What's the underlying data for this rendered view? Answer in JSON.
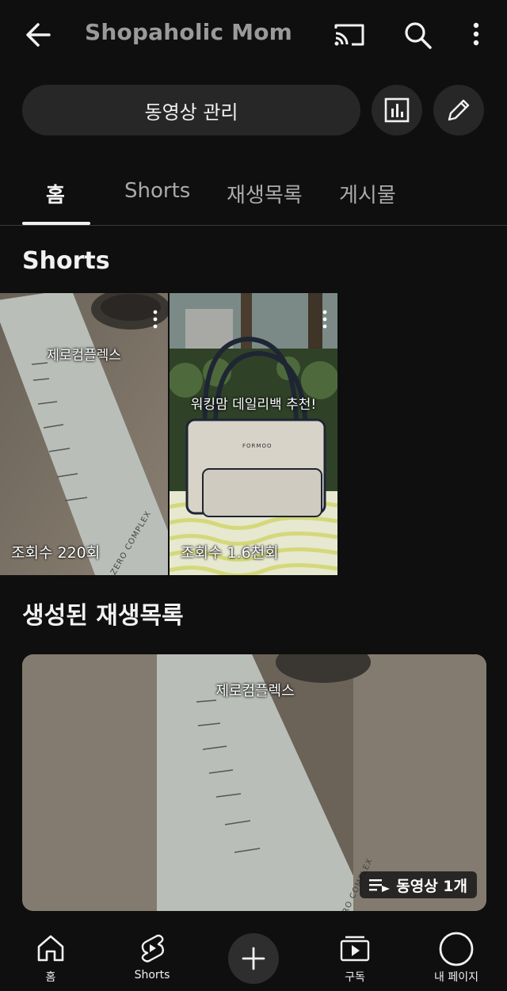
{
  "header": {
    "channel_name": "Shopaholic Mom"
  },
  "actions": {
    "manage_videos_label": "동영상 관리"
  },
  "tabs": [
    {
      "label": "홈",
      "active": true
    },
    {
      "label": "Shorts",
      "active": false
    },
    {
      "label": "재생목록",
      "active": false
    },
    {
      "label": "게시물",
      "active": false
    }
  ],
  "shorts_section": {
    "title": "Shorts",
    "items": [
      {
        "overlay_text": "제로컴플렉스",
        "views": "조회수 220회",
        "sheet_text": "ZERO COMPLEX"
      },
      {
        "overlay_text": "워킹맘 데일리백 추천!",
        "views": "조회수 1.6천회",
        "bag_brand": "FORMOO"
      }
    ]
  },
  "playlists_section": {
    "title": "생성된 재생목록",
    "thumb_overlay_text": "제로컴플렉스",
    "thumb_sheet_text": "ZERO COMPLEX",
    "badge": "동영상 1개"
  },
  "bottom_nav": {
    "home": "홈",
    "shorts": "Shorts",
    "subscriptions": "구독",
    "you": "내 페이지"
  },
  "icons": {
    "back": "arrow-left-icon",
    "cast": "cast-icon",
    "search": "search-icon",
    "more": "more-vertical-icon",
    "analytics": "bar-chart-icon",
    "edit": "pencil-icon",
    "add": "plus-icon"
  },
  "colors": {
    "background": "#0f0f0f",
    "surface": "#272727",
    "text": "#f1f1f1",
    "muted": "#aaaaaa"
  }
}
